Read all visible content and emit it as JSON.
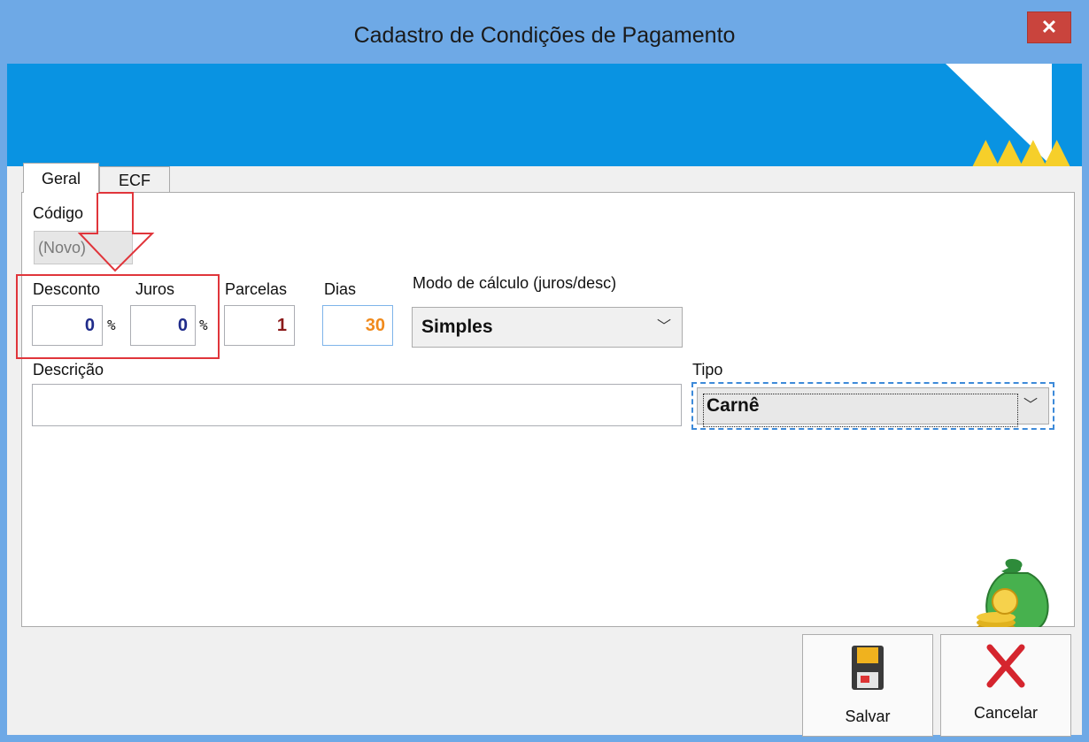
{
  "window": {
    "title": "Cadastro de Condições de Pagamento",
    "close_label": "✕"
  },
  "tabs": [
    {
      "label": "Geral",
      "active": true
    },
    {
      "label": "ECF",
      "active": false
    }
  ],
  "form": {
    "codigo": {
      "label": "Código",
      "value": "(Novo)"
    },
    "desconto": {
      "label": "Desconto",
      "value": "0",
      "unit": "%",
      "color": "#1f2b8a"
    },
    "juros": {
      "label": "Juros",
      "value": "0",
      "unit": "%",
      "color": "#1f2b8a"
    },
    "parcelas": {
      "label": "Parcelas",
      "value": "1",
      "color": "#8b1a1a"
    },
    "dias": {
      "label": "Dias",
      "value": "30",
      "color": "#f08a1c"
    },
    "modo_calculo": {
      "label": "Modo de cálculo (juros/desc)",
      "value": "Simples"
    },
    "descricao": {
      "label": "Descrição",
      "value": ""
    },
    "tipo": {
      "label": "Tipo",
      "value": "Carnê"
    }
  },
  "buttons": {
    "salvar": "Salvar",
    "cancelar": "Cancelar"
  },
  "colors": {
    "titlebar": "#6ea9e6",
    "banner": "#0993e2",
    "close": "#c9443d",
    "annotation": "#e0353b",
    "focus": "#3d8ad9"
  },
  "icons": [
    "close-icon",
    "chevron-down-icon",
    "money-bag-icon",
    "floppy-disk-icon",
    "red-x-icon"
  ]
}
